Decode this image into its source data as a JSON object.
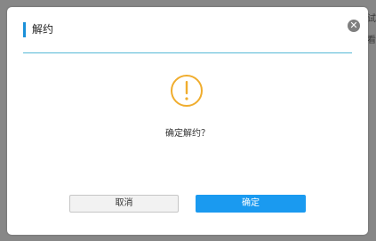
{
  "background": {
    "text_1": "试",
    "text_2": "看"
  },
  "dialog": {
    "title": "解约",
    "close_glyph": "✕",
    "message": "确定解约？",
    "cancel_label": "取消",
    "confirm_label": "确定",
    "icon": "warning-circle-icon"
  },
  "colors": {
    "accent": "#1a90d9",
    "confirm_button": "#1a9af0",
    "warning": "#f0ad2e",
    "header_divider": "#57b9d6",
    "overlay": "#878787"
  }
}
